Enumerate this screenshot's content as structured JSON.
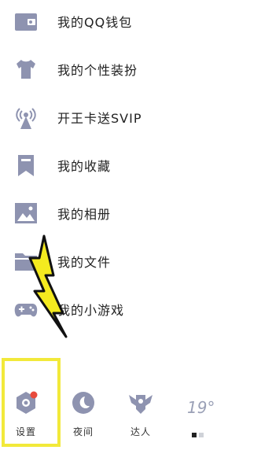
{
  "menu": {
    "items": [
      {
        "label": "我的QQ钱包",
        "icon": "wallet-icon"
      },
      {
        "label": "我的个性装扮",
        "icon": "tshirt-icon"
      },
      {
        "label": "开王卡送SVIP",
        "icon": "signal-tower-icon"
      },
      {
        "label": "我的收藏",
        "icon": "bookmark-icon"
      },
      {
        "label": "我的相册",
        "icon": "photo-icon"
      },
      {
        "label": "我的文件",
        "icon": "folder-icon"
      },
      {
        "label": "我的小游戏",
        "icon": "gamepad-icon"
      }
    ]
  },
  "bottom_bar": {
    "settings_label": "设置",
    "night_label": "夜间",
    "expert_label": "达人",
    "weather_temp": "19°"
  },
  "colors": {
    "icon": "#8e93b0",
    "badge": "#e84a3c",
    "highlight": "#f2e93a",
    "bolt": "#f4ea1f"
  }
}
